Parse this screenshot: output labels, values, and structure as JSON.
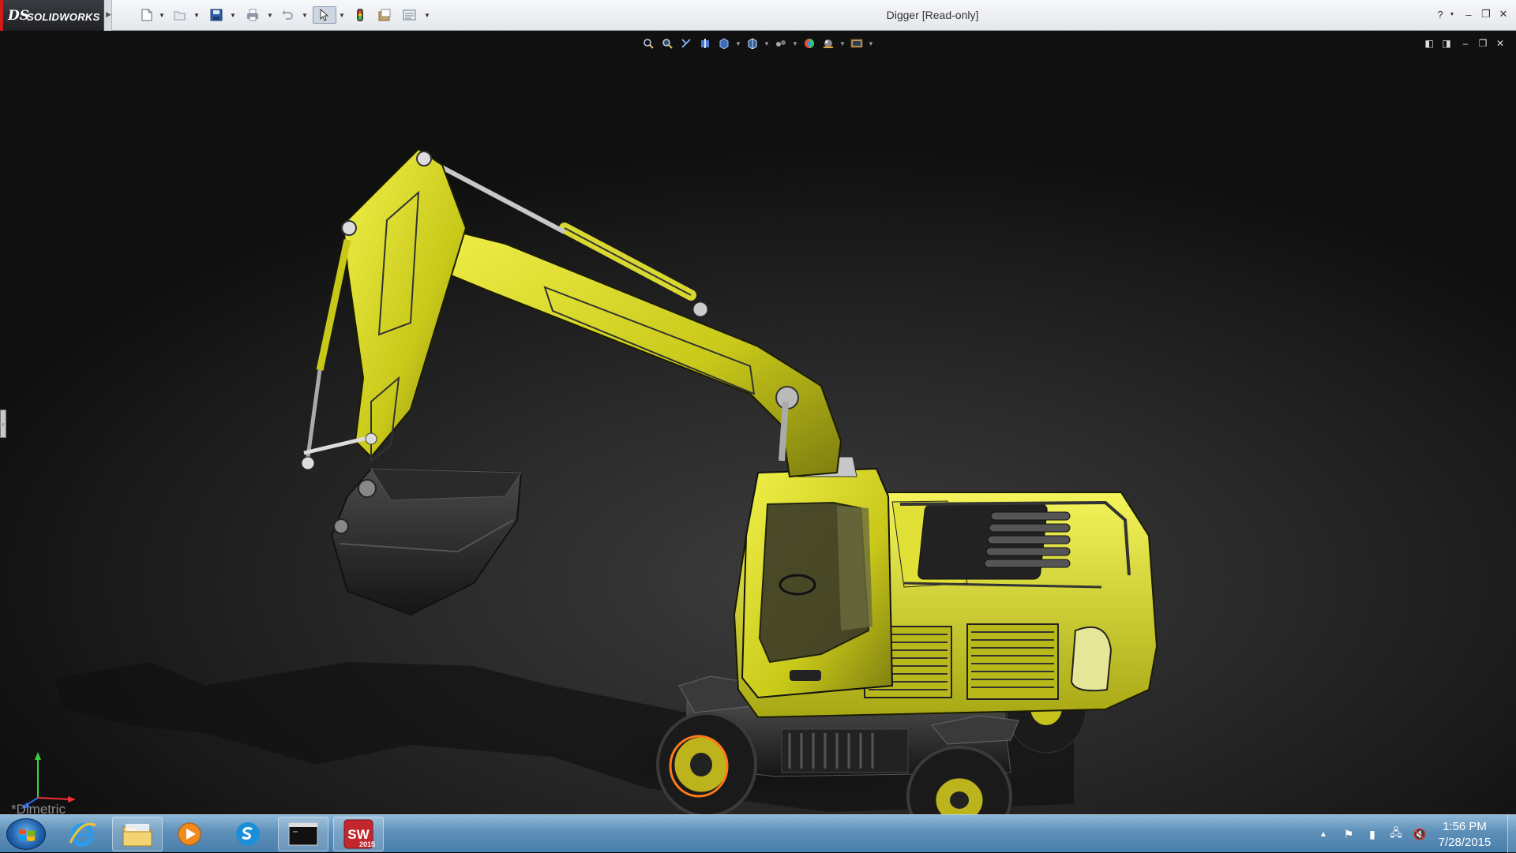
{
  "app": {
    "brand": "SOLIDWORKS",
    "logo_mark": "DS",
    "document_title": "Digger [Read-only]"
  },
  "toolbar": {
    "items": [
      {
        "name": "new-document-icon",
        "glyph": "🗋"
      },
      {
        "name": "open-document-icon",
        "glyph": "📂"
      },
      {
        "name": "save-icon",
        "glyph": "💾"
      },
      {
        "name": "print-icon",
        "glyph": "🖶"
      },
      {
        "name": "undo-icon",
        "glyph": "↶"
      },
      {
        "name": "select-icon",
        "glyph": "⇖"
      },
      {
        "name": "rebuild-icon",
        "glyph": "🚦"
      },
      {
        "name": "file-properties-icon",
        "glyph": "▣"
      },
      {
        "name": "options-icon",
        "glyph": "☰"
      }
    ]
  },
  "window_controls": {
    "help": "?",
    "minimize": "–",
    "restore": "❐",
    "close": "✕"
  },
  "heads_up_toolbar": {
    "items": [
      {
        "name": "zoom-to-fit-icon",
        "glyph": "🔍"
      },
      {
        "name": "zoom-to-area-icon",
        "glyph": "🔎"
      },
      {
        "name": "previous-view-icon",
        "glyph": "↖"
      },
      {
        "name": "section-view-icon",
        "glyph": "▥"
      },
      {
        "name": "view-orientation-icon",
        "glyph": "◧"
      },
      {
        "name": "display-style-icon",
        "glyph": "◨"
      },
      {
        "name": "hide-show-items-icon",
        "glyph": "👁"
      },
      {
        "name": "edit-appearance-icon",
        "glyph": "◐"
      },
      {
        "name": "apply-scene-icon",
        "glyph": "◉"
      },
      {
        "name": "view-settings-icon",
        "glyph": "▤"
      }
    ]
  },
  "viewport_controls": {
    "tile_left": "◧",
    "tile_right": "◨",
    "minimize": "–",
    "restore": "❐",
    "close": "✕"
  },
  "view": {
    "orientation_label": "*Dimetric"
  },
  "taskbar": {
    "apps": [
      {
        "name": "internet-explorer-icon"
      },
      {
        "name": "file-explorer-icon"
      },
      {
        "name": "media-player-icon"
      },
      {
        "name": "skype-icon"
      },
      {
        "name": "command-prompt-icon"
      },
      {
        "name": "solidworks-2015-icon",
        "label": "2015"
      }
    ],
    "clock": {
      "time": "1:56 PM",
      "date": "7/28/2015"
    }
  },
  "colors": {
    "machine_yellow": "#d4d418",
    "titlebar": "#eef0f3",
    "taskbar": "#5d8fb8",
    "highlight_orange": "#ff7a1a"
  }
}
